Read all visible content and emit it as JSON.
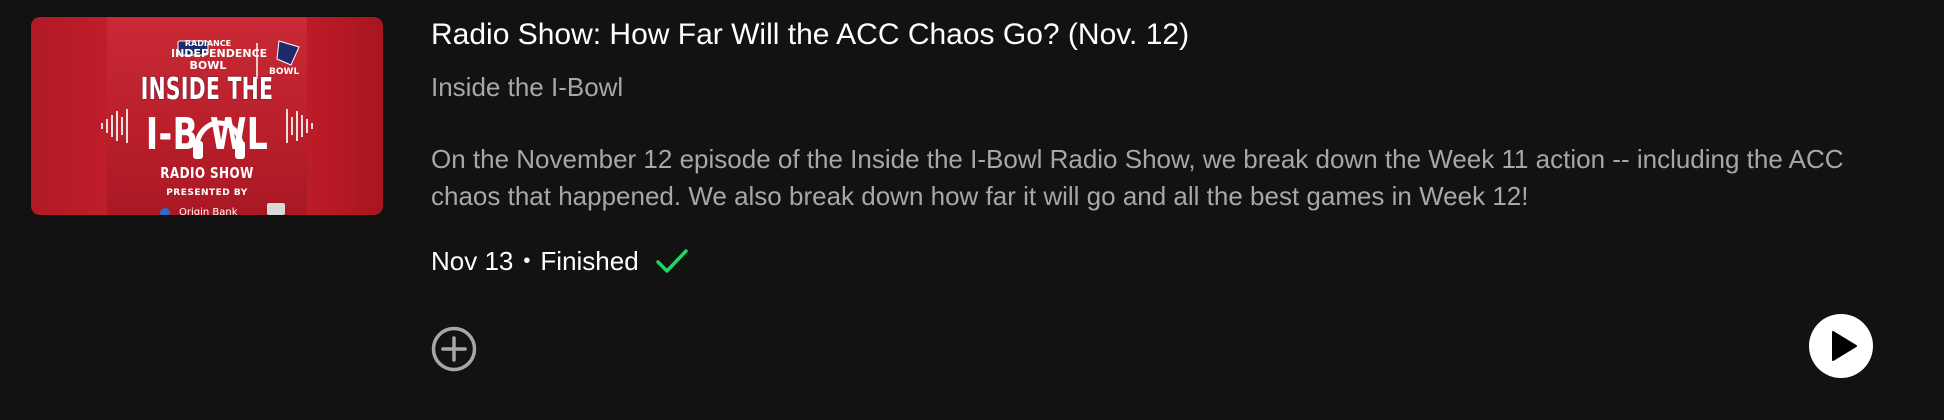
{
  "episode": {
    "artwork": {
      "brand_left_top": "RADIANCE",
      "brand_left_line1": "INDEPENDENCE",
      "brand_left_line2": "BOWL",
      "brand_right": "BOWL",
      "title_line1": "INSIDE THE",
      "title_line2": "I-B    WL",
      "subtitle": "RADIO SHOW",
      "presented_by": "PRESENTED BY",
      "sponsor": "Origin Bank"
    },
    "title": "Radio Show: How Far Will the ACC Chaos Go? (Nov. 12)",
    "show_name": "Inside the I-Bowl",
    "description": "On the November 12 episode of the Inside the I-Bowl Radio Show, we break down the Week 11 action -- including the ACC chaos that happened. We also break down how far it will go and all the best games in Week 12!",
    "date": "Nov 13",
    "separator": "•",
    "status": "Finished"
  },
  "colors": {
    "background": "#121212",
    "text_primary": "#ffffff",
    "text_secondary": "#a7a7a7",
    "check_green": "#1ed760",
    "artwork_red": "#c41f2b"
  },
  "icons": {
    "finished": "check-icon",
    "add": "add-circle-icon",
    "play": "play-icon"
  }
}
